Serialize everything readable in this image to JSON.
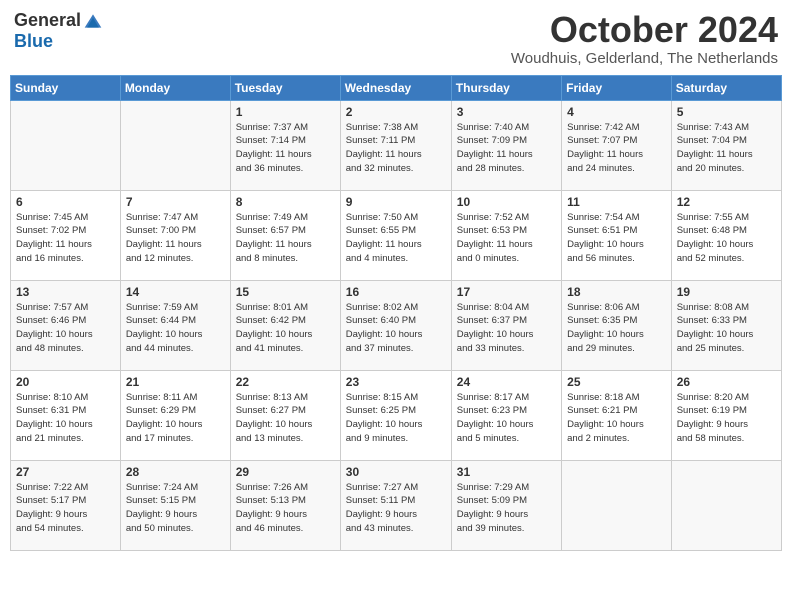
{
  "logo": {
    "general": "General",
    "blue": "Blue"
  },
  "title": {
    "month": "October 2024",
    "location": "Woudhuis, Gelderland, The Netherlands"
  },
  "weekdays": [
    "Sunday",
    "Monday",
    "Tuesday",
    "Wednesday",
    "Thursday",
    "Friday",
    "Saturday"
  ],
  "weeks": [
    [
      {
        "day": "",
        "info": ""
      },
      {
        "day": "",
        "info": ""
      },
      {
        "day": "1",
        "info": "Sunrise: 7:37 AM\nSunset: 7:14 PM\nDaylight: 11 hours\nand 36 minutes."
      },
      {
        "day": "2",
        "info": "Sunrise: 7:38 AM\nSunset: 7:11 PM\nDaylight: 11 hours\nand 32 minutes."
      },
      {
        "day": "3",
        "info": "Sunrise: 7:40 AM\nSunset: 7:09 PM\nDaylight: 11 hours\nand 28 minutes."
      },
      {
        "day": "4",
        "info": "Sunrise: 7:42 AM\nSunset: 7:07 PM\nDaylight: 11 hours\nand 24 minutes."
      },
      {
        "day": "5",
        "info": "Sunrise: 7:43 AM\nSunset: 7:04 PM\nDaylight: 11 hours\nand 20 minutes."
      }
    ],
    [
      {
        "day": "6",
        "info": "Sunrise: 7:45 AM\nSunset: 7:02 PM\nDaylight: 11 hours\nand 16 minutes."
      },
      {
        "day": "7",
        "info": "Sunrise: 7:47 AM\nSunset: 7:00 PM\nDaylight: 11 hours\nand 12 minutes."
      },
      {
        "day": "8",
        "info": "Sunrise: 7:49 AM\nSunset: 6:57 PM\nDaylight: 11 hours\nand 8 minutes."
      },
      {
        "day": "9",
        "info": "Sunrise: 7:50 AM\nSunset: 6:55 PM\nDaylight: 11 hours\nand 4 minutes."
      },
      {
        "day": "10",
        "info": "Sunrise: 7:52 AM\nSunset: 6:53 PM\nDaylight: 11 hours\nand 0 minutes."
      },
      {
        "day": "11",
        "info": "Sunrise: 7:54 AM\nSunset: 6:51 PM\nDaylight: 10 hours\nand 56 minutes."
      },
      {
        "day": "12",
        "info": "Sunrise: 7:55 AM\nSunset: 6:48 PM\nDaylight: 10 hours\nand 52 minutes."
      }
    ],
    [
      {
        "day": "13",
        "info": "Sunrise: 7:57 AM\nSunset: 6:46 PM\nDaylight: 10 hours\nand 48 minutes."
      },
      {
        "day": "14",
        "info": "Sunrise: 7:59 AM\nSunset: 6:44 PM\nDaylight: 10 hours\nand 44 minutes."
      },
      {
        "day": "15",
        "info": "Sunrise: 8:01 AM\nSunset: 6:42 PM\nDaylight: 10 hours\nand 41 minutes."
      },
      {
        "day": "16",
        "info": "Sunrise: 8:02 AM\nSunset: 6:40 PM\nDaylight: 10 hours\nand 37 minutes."
      },
      {
        "day": "17",
        "info": "Sunrise: 8:04 AM\nSunset: 6:37 PM\nDaylight: 10 hours\nand 33 minutes."
      },
      {
        "day": "18",
        "info": "Sunrise: 8:06 AM\nSunset: 6:35 PM\nDaylight: 10 hours\nand 29 minutes."
      },
      {
        "day": "19",
        "info": "Sunrise: 8:08 AM\nSunset: 6:33 PM\nDaylight: 10 hours\nand 25 minutes."
      }
    ],
    [
      {
        "day": "20",
        "info": "Sunrise: 8:10 AM\nSunset: 6:31 PM\nDaylight: 10 hours\nand 21 minutes."
      },
      {
        "day": "21",
        "info": "Sunrise: 8:11 AM\nSunset: 6:29 PM\nDaylight: 10 hours\nand 17 minutes."
      },
      {
        "day": "22",
        "info": "Sunrise: 8:13 AM\nSunset: 6:27 PM\nDaylight: 10 hours\nand 13 minutes."
      },
      {
        "day": "23",
        "info": "Sunrise: 8:15 AM\nSunset: 6:25 PM\nDaylight: 10 hours\nand 9 minutes."
      },
      {
        "day": "24",
        "info": "Sunrise: 8:17 AM\nSunset: 6:23 PM\nDaylight: 10 hours\nand 5 minutes."
      },
      {
        "day": "25",
        "info": "Sunrise: 8:18 AM\nSunset: 6:21 PM\nDaylight: 10 hours\nand 2 minutes."
      },
      {
        "day": "26",
        "info": "Sunrise: 8:20 AM\nSunset: 6:19 PM\nDaylight: 9 hours\nand 58 minutes."
      }
    ],
    [
      {
        "day": "27",
        "info": "Sunrise: 7:22 AM\nSunset: 5:17 PM\nDaylight: 9 hours\nand 54 minutes."
      },
      {
        "day": "28",
        "info": "Sunrise: 7:24 AM\nSunset: 5:15 PM\nDaylight: 9 hours\nand 50 minutes."
      },
      {
        "day": "29",
        "info": "Sunrise: 7:26 AM\nSunset: 5:13 PM\nDaylight: 9 hours\nand 46 minutes."
      },
      {
        "day": "30",
        "info": "Sunrise: 7:27 AM\nSunset: 5:11 PM\nDaylight: 9 hours\nand 43 minutes."
      },
      {
        "day": "31",
        "info": "Sunrise: 7:29 AM\nSunset: 5:09 PM\nDaylight: 9 hours\nand 39 minutes."
      },
      {
        "day": "",
        "info": ""
      },
      {
        "day": "",
        "info": ""
      }
    ]
  ]
}
